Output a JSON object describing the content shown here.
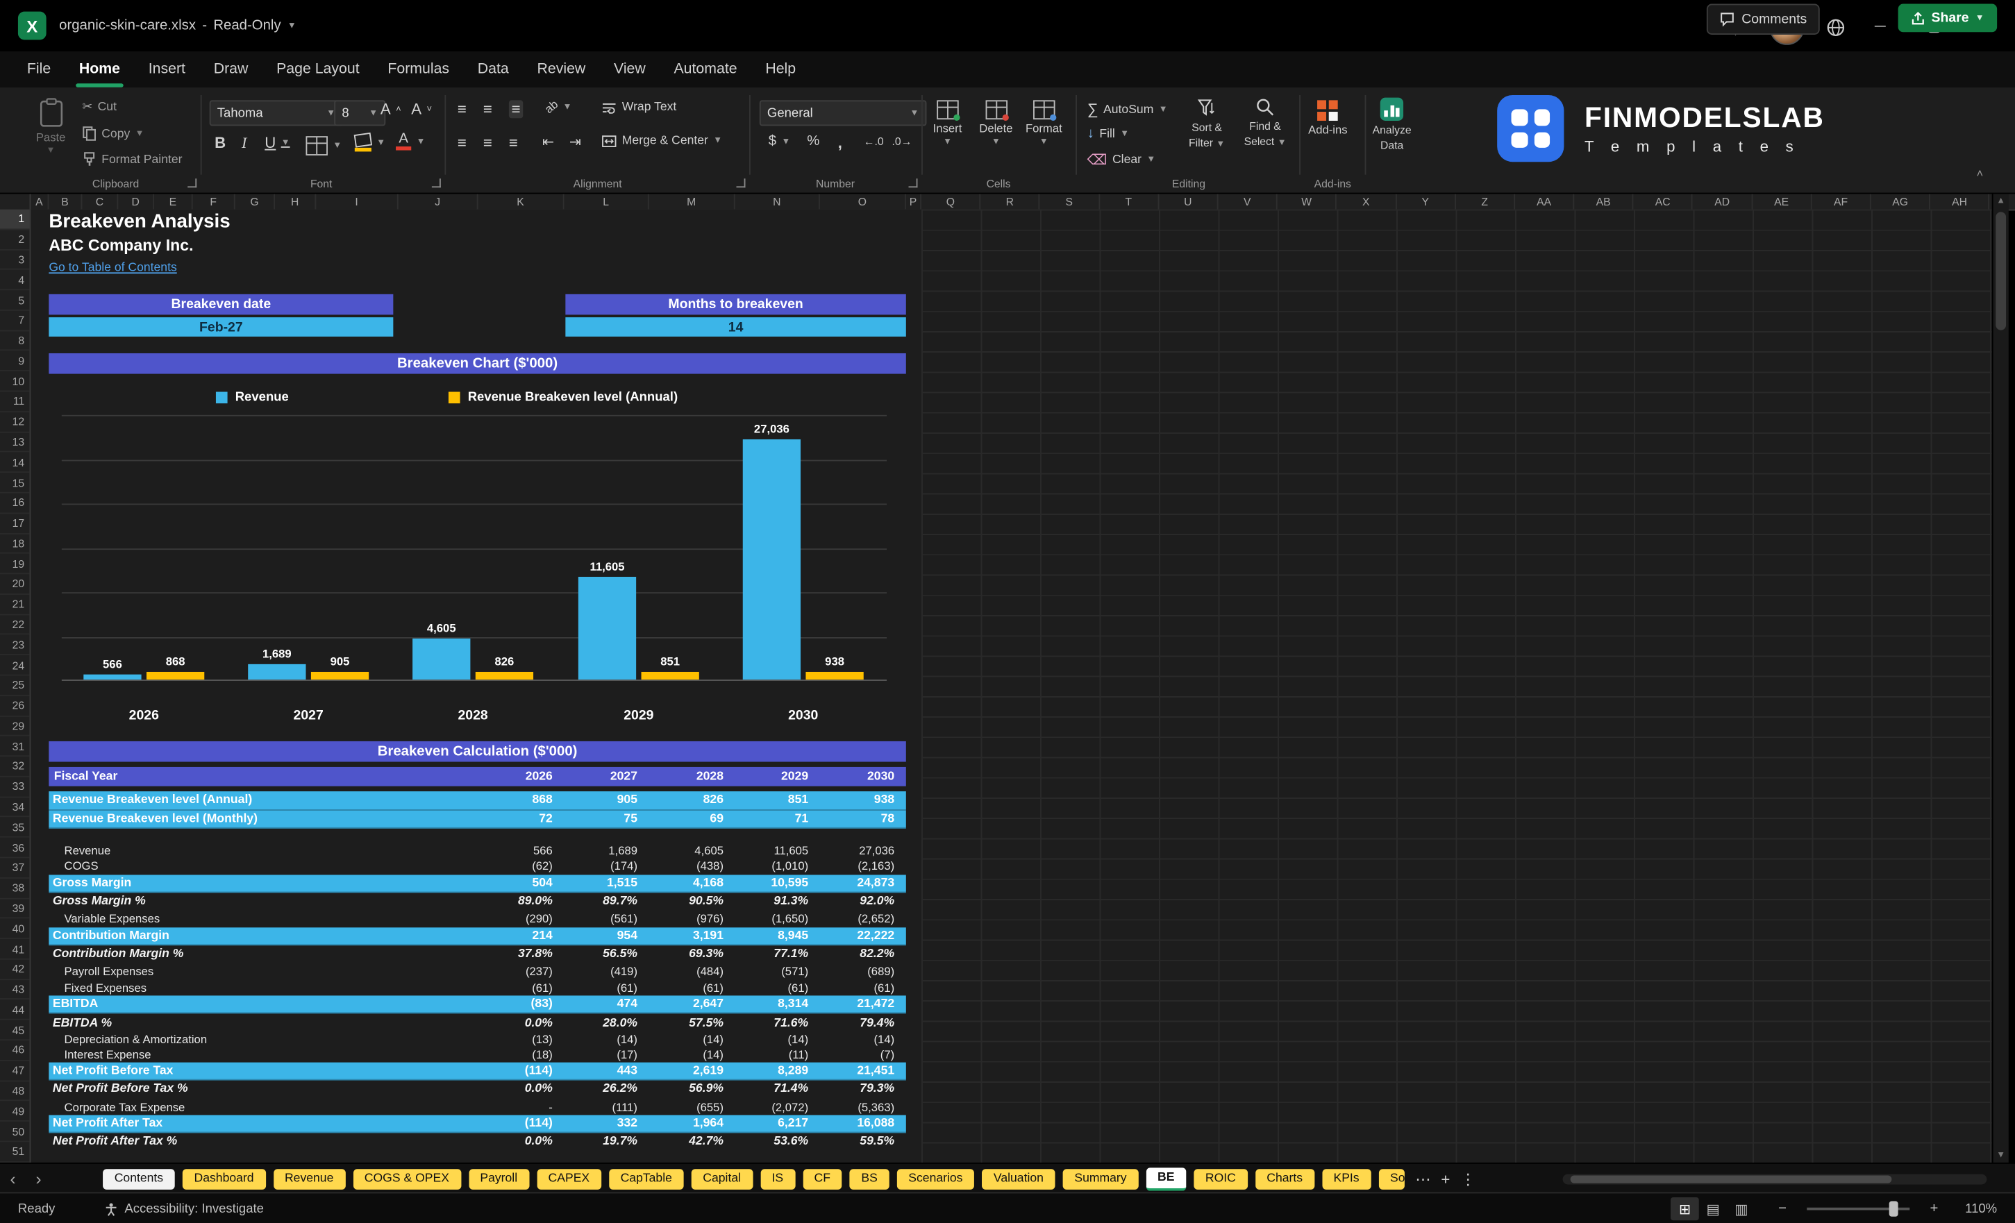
{
  "window": {
    "filename": "organic-skin-care.xlsx",
    "separator": "-",
    "mode": "Read-Only"
  },
  "menu_tabs": [
    "File",
    "Home",
    "Insert",
    "Draw",
    "Page Layout",
    "Formulas",
    "Data",
    "Review",
    "View",
    "Automate",
    "Help"
  ],
  "active_menu_tab": "Home",
  "topright": {
    "comments": "Comments",
    "share": "Share"
  },
  "ribbon": {
    "clipboard": {
      "label": "Clipboard",
      "paste": "Paste",
      "cut": "Cut",
      "copy": "Copy",
      "format_painter": "Format Painter"
    },
    "font": {
      "label": "Font",
      "family": "Tahoma",
      "size": "8"
    },
    "alignment": {
      "label": "Alignment",
      "wrap": "Wrap Text",
      "merge": "Merge & Center"
    },
    "number": {
      "label": "Number",
      "format": "General"
    },
    "cells": {
      "label": "Cells",
      "insert": "Insert",
      "delete": "Delete",
      "format": "Format"
    },
    "editing": {
      "label": "Editing",
      "autosum": "AutoSum",
      "fill": "Fill",
      "clear": "Clear",
      "sort1": "Sort &",
      "sort2": "Filter",
      "find1": "Find &",
      "find2": "Select"
    },
    "addins": {
      "label": "Add-ins",
      "addins": "Add-ins",
      "analyze1": "Analyze",
      "analyze2": "Data"
    },
    "brand": {
      "name": "FINMODELSLAB",
      "sub": "T e m p l a t e s"
    }
  },
  "grid": {
    "columns": [
      "A",
      "B",
      "C",
      "D",
      "E",
      "F",
      "G",
      "H",
      "I",
      "J",
      "K",
      "L",
      "M",
      "N",
      "O",
      "P",
      "Q",
      "R",
      "S",
      "T",
      "U",
      "V",
      "W",
      "X",
      "Y",
      "Z",
      "AA",
      "AB",
      "AC",
      "AD",
      "AE",
      "AF",
      "AG",
      "AH"
    ],
    "rows": [
      1,
      2,
      3,
      4,
      5,
      7,
      8,
      9,
      10,
      11,
      12,
      13,
      14,
      15,
      16,
      17,
      18,
      19,
      20,
      21,
      22,
      23,
      24,
      25,
      26,
      29,
      31,
      32,
      33,
      34,
      35,
      36,
      37,
      38,
      39,
      40,
      41,
      42,
      43,
      44,
      45,
      46,
      47,
      48,
      49,
      50,
      51
    ]
  },
  "doc": {
    "title": "Breakeven Analysis",
    "company": "ABC Company Inc.",
    "link": "Go to Table of Contents",
    "cards": [
      {
        "header": "Breakeven date",
        "value": "Feb-27"
      },
      {
        "header": "Months to breakeven",
        "value": "14"
      }
    ]
  },
  "chart_data": {
    "type": "bar",
    "title": "Breakeven Chart ($'000)",
    "categories": [
      "2026",
      "2027",
      "2028",
      "2029",
      "2030"
    ],
    "series": [
      {
        "name": "Revenue",
        "color": "#3cb5e8",
        "values": [
          566,
          1689,
          4605,
          11605,
          27036
        ],
        "labels": [
          "566",
          "1,689",
          "4,605",
          "11,605",
          "27,036"
        ]
      },
      {
        "name": "Revenue Breakeven level (Annual)",
        "color": "#ffc000",
        "values": [
          868,
          905,
          826,
          851,
          938
        ],
        "labels": [
          "868",
          "905",
          "826",
          "851",
          "938"
        ]
      }
    ],
    "ylim": [
      0,
      30000
    ],
    "gridline_step": 5000,
    "legend_position": "top",
    "grid": true
  },
  "table": {
    "title": "Breakeven Calculation ($'000)",
    "header": {
      "label": "Fiscal Year",
      "years": [
        "2026",
        "2027",
        "2028",
        "2029",
        "2030"
      ]
    },
    "rows": [
      {
        "label": "Revenue Breakeven level (Annual)",
        "values": [
          "868",
          "905",
          "826",
          "851",
          "938"
        ],
        "style": "highlight"
      },
      {
        "label": "Revenue Breakeven level (Monthly)",
        "values": [
          "72",
          "75",
          "69",
          "71",
          "78"
        ],
        "style": "highlight"
      },
      {
        "style": "spacer"
      },
      {
        "label": "Revenue",
        "values": [
          "566",
          "1,689",
          "4,605",
          "11,605",
          "27,036"
        ],
        "style": "plain"
      },
      {
        "label": "COGS",
        "values": [
          "(62)",
          "(174)",
          "(438)",
          "(1,010)",
          "(2,163)"
        ],
        "style": "plain"
      },
      {
        "label": "Gross Margin",
        "values": [
          "504",
          "1,515",
          "4,168",
          "10,595",
          "24,873"
        ],
        "style": "highlight"
      },
      {
        "label": "Gross Margin %",
        "values": [
          "89.0%",
          "89.7%",
          "90.5%",
          "91.3%",
          "92.0%"
        ],
        "style": "pct"
      },
      {
        "label": "Variable Expenses",
        "values": [
          "(290)",
          "(561)",
          "(976)",
          "(1,650)",
          "(2,652)"
        ],
        "style": "plain"
      },
      {
        "label": "Contribution Margin",
        "values": [
          "214",
          "954",
          "3,191",
          "8,945",
          "22,222"
        ],
        "style": "highlight"
      },
      {
        "label": "Contribution Margin %",
        "values": [
          "37.8%",
          "56.5%",
          "69.3%",
          "77.1%",
          "82.2%"
        ],
        "style": "pct"
      },
      {
        "label": "Payroll Expenses",
        "values": [
          "(237)",
          "(419)",
          "(484)",
          "(571)",
          "(689)"
        ],
        "style": "plain"
      },
      {
        "label": "Fixed Expenses",
        "values": [
          "(61)",
          "(61)",
          "(61)",
          "(61)",
          "(61)"
        ],
        "style": "plain"
      },
      {
        "label": "EBITDA",
        "values": [
          "(83)",
          "474",
          "2,647",
          "8,314",
          "21,472"
        ],
        "style": "highlight"
      },
      {
        "label": "EBITDA %",
        "values": [
          "0.0%",
          "28.0%",
          "57.5%",
          "71.6%",
          "79.4%"
        ],
        "style": "pct"
      },
      {
        "label": "Depreciation & Amortization",
        "values": [
          "(13)",
          "(14)",
          "(14)",
          "(14)",
          "(14)"
        ],
        "style": "plain"
      },
      {
        "label": "Interest Expense",
        "values": [
          "(18)",
          "(17)",
          "(14)",
          "(11)",
          "(7)"
        ],
        "style": "plain"
      },
      {
        "label": "Net Profit Before Tax",
        "values": [
          "(114)",
          "443",
          "2,619",
          "8,289",
          "21,451"
        ],
        "style": "highlight"
      },
      {
        "label": "Net Profit Before Tax %",
        "values": [
          "0.0%",
          "26.2%",
          "56.9%",
          "71.4%",
          "79.3%"
        ],
        "style": "pct"
      },
      {
        "label": "Corporate Tax Expense",
        "values": [
          "-",
          "(111)",
          "(655)",
          "(2,072)",
          "(5,363)"
        ],
        "style": "plain"
      },
      {
        "label": "Net Profit After Tax",
        "values": [
          "(114)",
          "332",
          "1,964",
          "6,217",
          "16,088"
        ],
        "style": "highlight"
      },
      {
        "label": "Net Profit After Tax %",
        "values": [
          "0.0%",
          "19.7%",
          "42.7%",
          "53.6%",
          "59.5%"
        ],
        "style": "pct"
      }
    ]
  },
  "sheet_tabs": [
    {
      "label": "Contents",
      "style": "light"
    },
    {
      "label": "Dashboard",
      "style": "yellow"
    },
    {
      "label": "Revenue",
      "style": "yellow"
    },
    {
      "label": "COGS & OPEX",
      "style": "yellow"
    },
    {
      "label": "Payroll",
      "style": "yellow"
    },
    {
      "label": "CAPEX",
      "style": "yellow"
    },
    {
      "label": "CapTable",
      "style": "yellow"
    },
    {
      "label": "Capital",
      "style": "yellow"
    },
    {
      "label": "IS",
      "style": "yellow"
    },
    {
      "label": "CF",
      "style": "yellow"
    },
    {
      "label": "BS",
      "style": "yellow"
    },
    {
      "label": "Scenarios",
      "style": "yellow"
    },
    {
      "label": "Valuation",
      "style": "yellow"
    },
    {
      "label": "Summary",
      "style": "yellow"
    },
    {
      "label": "BE",
      "style": "active"
    },
    {
      "label": "ROIC",
      "style": "yellow"
    },
    {
      "label": "Charts",
      "style": "yellow"
    },
    {
      "label": "KPIs",
      "style": "yellow"
    },
    {
      "label": "So",
      "style": "yellow clipped"
    }
  ],
  "status": {
    "ready": "Ready",
    "accessibility": "Accessibility: Investigate",
    "zoom": "110%"
  },
  "colors": {
    "accent_purple": "#4f55cb",
    "accent_blue": "#3cb5e8",
    "accent_yellow": "#ffc000",
    "excel_green": "#21a366",
    "tab_yellow": "#ffd84d"
  }
}
